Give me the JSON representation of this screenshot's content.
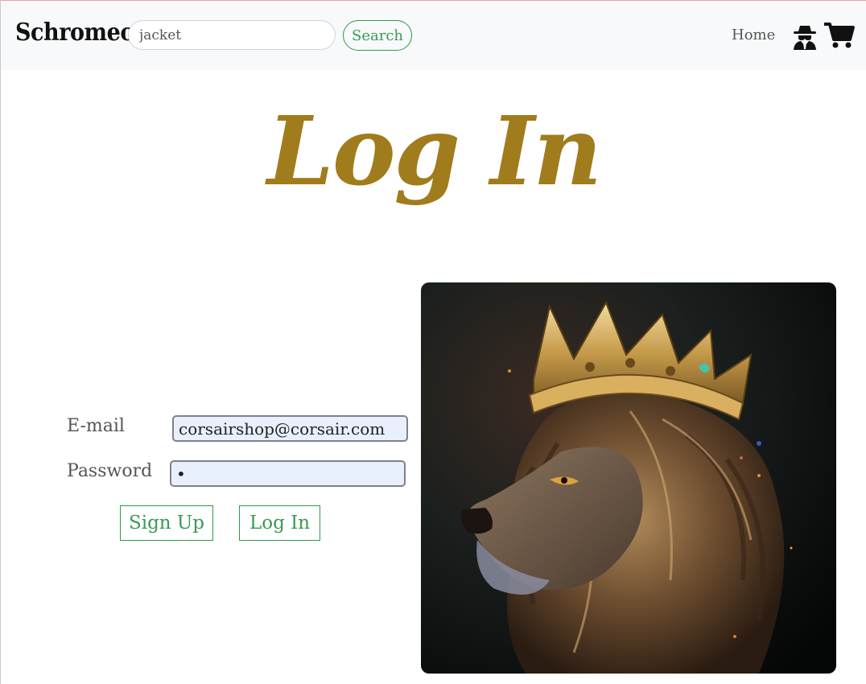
{
  "brand": "Schromeo",
  "search": {
    "value": "jacket",
    "button_label": "Search"
  },
  "nav": {
    "home_label": "Home",
    "account_icon": "spy-icon",
    "cart_icon": "cart-icon"
  },
  "page": {
    "title": "Log In"
  },
  "form": {
    "email_label": "E-mail",
    "email_value": "corsairshop@corsair.com",
    "password_label": "Password",
    "password_value": "•",
    "signup_label": "Sign Up",
    "login_label": "Log In"
  },
  "hero": {
    "image": "crowned-lion-illustration"
  },
  "colors": {
    "accent_green": "#3a9a55",
    "title_gold": "#a07c1c",
    "navbar_bg": "#f8f9fa",
    "autofill_bg": "#e8f0fe"
  }
}
